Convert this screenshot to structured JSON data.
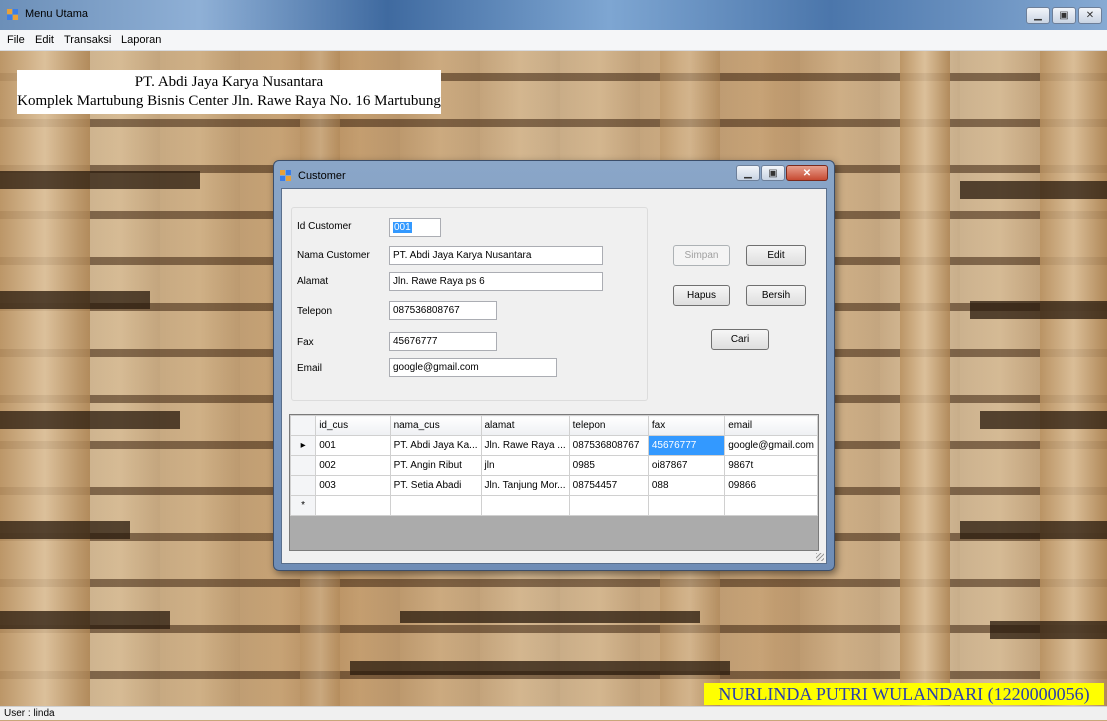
{
  "window": {
    "title": "Menu Utama"
  },
  "menu": [
    "File",
    "Edit",
    "Transaksi",
    "Laporan"
  ],
  "company": {
    "name": "PT. Abdi Jaya Karya Nusantara",
    "address": "Komplek Martubung Bisnis Center Jln. Rawe Raya No. 16 Martubung"
  },
  "customer_window": {
    "title": "Customer",
    "labels": {
      "id": "Id Customer",
      "name": "Nama Customer",
      "address": "Alamat",
      "phone": "Telepon",
      "fax": "Fax",
      "email": "Email"
    },
    "fields": {
      "id": "001",
      "name": "PT. Abdi Jaya Karya Nusantara",
      "address": "Jln. Rawe Raya ps 6",
      "phone": "087536808767",
      "fax": "45676777",
      "email": "google@gmail.com"
    },
    "buttons": {
      "save": "Simpan",
      "edit": "Edit",
      "delete": "Hapus",
      "clear": "Bersih",
      "search": "Cari"
    },
    "grid": {
      "columns": [
        "id_cus",
        "nama_cus",
        "alamat",
        "telepon",
        "fax",
        "email"
      ],
      "rows": [
        [
          "001",
          "PT. Abdi Jaya Ka...",
          "Jln. Rawe Raya ...",
          "087536808767",
          "45676777",
          "google@gmail.com"
        ],
        [
          "002",
          "PT. Angin Ribut",
          "jln",
          "0985",
          "oi87867",
          "9867t"
        ],
        [
          "003",
          "PT. Setia Abadi",
          "Jln. Tanjung Mor...",
          "08754457",
          "088",
          "09866"
        ]
      ],
      "current_row_marker": "▸",
      "new_row_marker": "*"
    }
  },
  "footer": {
    "author": "NURLINDA PUTRI WULANDARI (1220000056)"
  },
  "status": {
    "user": "User : linda"
  }
}
